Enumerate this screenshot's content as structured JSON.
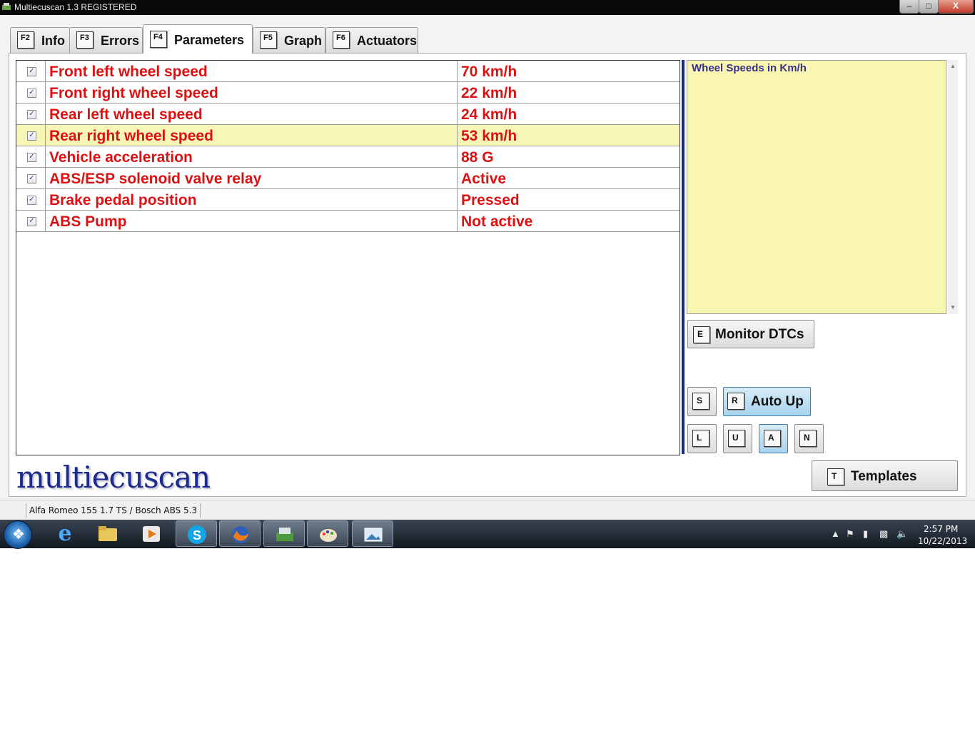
{
  "window": {
    "title": "Multiecuscan 1.3 REGISTERED",
    "minimize": "–",
    "maximize": "□",
    "close": "X"
  },
  "tabs": [
    {
      "key": "F2",
      "label": "Info"
    },
    {
      "key": "F3",
      "label": "Errors"
    },
    {
      "key": "F4",
      "label": "Parameters"
    },
    {
      "key": "F5",
      "label": "Graph"
    },
    {
      "key": "F6",
      "label": "Actuators"
    }
  ],
  "parameters": [
    {
      "name": "Front left wheel speed",
      "value": "70 km/h",
      "checked": true
    },
    {
      "name": "Front right wheel speed",
      "value": "22 km/h",
      "checked": true
    },
    {
      "name": "Rear left wheel speed",
      "value": "24 km/h",
      "checked": true
    },
    {
      "name": "Rear right wheel speed",
      "value": "53 km/h",
      "checked": true
    },
    {
      "name": "Vehicle acceleration",
      "value": "88 G",
      "checked": true
    },
    {
      "name": "ABS/ESP solenoid valve relay",
      "value": "Active",
      "checked": true
    },
    {
      "name": "Brake pedal position",
      "value": "Pressed",
      "checked": true
    },
    {
      "name": "ABS Pump",
      "value": "Not active",
      "checked": true
    }
  ],
  "checkmark": "✓",
  "description": "Wheel Speeds in Km/h",
  "buttons": {
    "monitor": {
      "key": "E",
      "label": "Monitor DTCs"
    },
    "s": {
      "key": "S"
    },
    "autoup": {
      "key": "R",
      "label": "Auto Up"
    },
    "l": {
      "key": "L"
    },
    "u": {
      "key": "U"
    },
    "a": {
      "key": "A"
    },
    "n": {
      "key": "N"
    },
    "templates": {
      "key": "T",
      "label": "Templates"
    }
  },
  "logo": "multiecuscan",
  "status": "Alfa Romeo 155 1.7 TS / Bosch ABS 5.3",
  "clock": {
    "time": "2:57 PM",
    "date": "10/22/2013"
  },
  "colors": {
    "value_text": "#dd1111",
    "highlight_row": "#f8f6b6",
    "description_bg": "#f8f6b0",
    "brand": "#1b2a8c"
  }
}
